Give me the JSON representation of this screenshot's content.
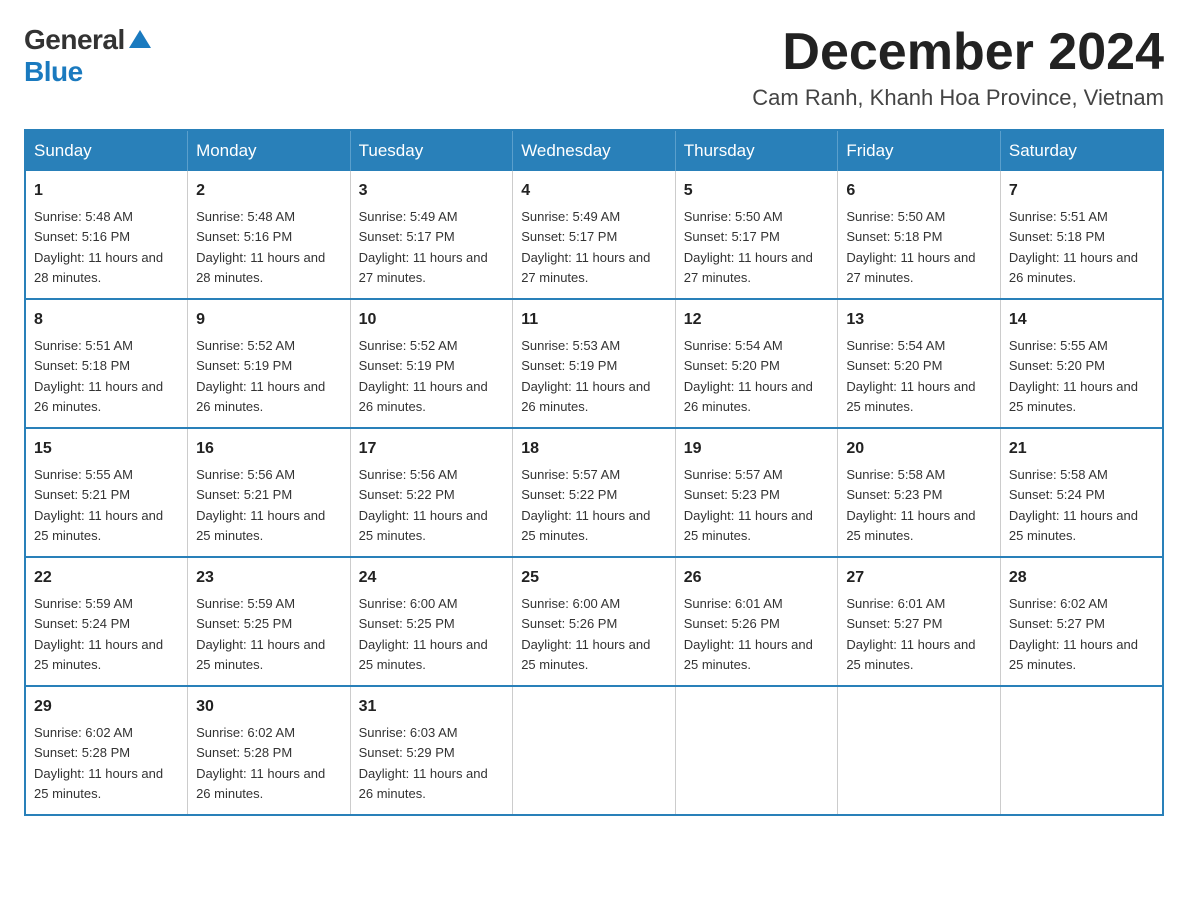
{
  "logo": {
    "general": "General",
    "blue": "Blue"
  },
  "title": "December 2024",
  "location": "Cam Ranh, Khanh Hoa Province, Vietnam",
  "weekdays": [
    "Sunday",
    "Monday",
    "Tuesday",
    "Wednesday",
    "Thursday",
    "Friday",
    "Saturday"
  ],
  "weeks": [
    [
      {
        "day": "1",
        "sunrise": "5:48 AM",
        "sunset": "5:16 PM",
        "daylight": "11 hours and 28 minutes."
      },
      {
        "day": "2",
        "sunrise": "5:48 AM",
        "sunset": "5:16 PM",
        "daylight": "11 hours and 28 minutes."
      },
      {
        "day": "3",
        "sunrise": "5:49 AM",
        "sunset": "5:17 PM",
        "daylight": "11 hours and 27 minutes."
      },
      {
        "day": "4",
        "sunrise": "5:49 AM",
        "sunset": "5:17 PM",
        "daylight": "11 hours and 27 minutes."
      },
      {
        "day": "5",
        "sunrise": "5:50 AM",
        "sunset": "5:17 PM",
        "daylight": "11 hours and 27 minutes."
      },
      {
        "day": "6",
        "sunrise": "5:50 AM",
        "sunset": "5:18 PM",
        "daylight": "11 hours and 27 minutes."
      },
      {
        "day": "7",
        "sunrise": "5:51 AM",
        "sunset": "5:18 PM",
        "daylight": "11 hours and 26 minutes."
      }
    ],
    [
      {
        "day": "8",
        "sunrise": "5:51 AM",
        "sunset": "5:18 PM",
        "daylight": "11 hours and 26 minutes."
      },
      {
        "day": "9",
        "sunrise": "5:52 AM",
        "sunset": "5:19 PM",
        "daylight": "11 hours and 26 minutes."
      },
      {
        "day": "10",
        "sunrise": "5:52 AM",
        "sunset": "5:19 PM",
        "daylight": "11 hours and 26 minutes."
      },
      {
        "day": "11",
        "sunrise": "5:53 AM",
        "sunset": "5:19 PM",
        "daylight": "11 hours and 26 minutes."
      },
      {
        "day": "12",
        "sunrise": "5:54 AM",
        "sunset": "5:20 PM",
        "daylight": "11 hours and 26 minutes."
      },
      {
        "day": "13",
        "sunrise": "5:54 AM",
        "sunset": "5:20 PM",
        "daylight": "11 hours and 25 minutes."
      },
      {
        "day": "14",
        "sunrise": "5:55 AM",
        "sunset": "5:20 PM",
        "daylight": "11 hours and 25 minutes."
      }
    ],
    [
      {
        "day": "15",
        "sunrise": "5:55 AM",
        "sunset": "5:21 PM",
        "daylight": "11 hours and 25 minutes."
      },
      {
        "day": "16",
        "sunrise": "5:56 AM",
        "sunset": "5:21 PM",
        "daylight": "11 hours and 25 minutes."
      },
      {
        "day": "17",
        "sunrise": "5:56 AM",
        "sunset": "5:22 PM",
        "daylight": "11 hours and 25 minutes."
      },
      {
        "day": "18",
        "sunrise": "5:57 AM",
        "sunset": "5:22 PM",
        "daylight": "11 hours and 25 minutes."
      },
      {
        "day": "19",
        "sunrise": "5:57 AM",
        "sunset": "5:23 PM",
        "daylight": "11 hours and 25 minutes."
      },
      {
        "day": "20",
        "sunrise": "5:58 AM",
        "sunset": "5:23 PM",
        "daylight": "11 hours and 25 minutes."
      },
      {
        "day": "21",
        "sunrise": "5:58 AM",
        "sunset": "5:24 PM",
        "daylight": "11 hours and 25 minutes."
      }
    ],
    [
      {
        "day": "22",
        "sunrise": "5:59 AM",
        "sunset": "5:24 PM",
        "daylight": "11 hours and 25 minutes."
      },
      {
        "day": "23",
        "sunrise": "5:59 AM",
        "sunset": "5:25 PM",
        "daylight": "11 hours and 25 minutes."
      },
      {
        "day": "24",
        "sunrise": "6:00 AM",
        "sunset": "5:25 PM",
        "daylight": "11 hours and 25 minutes."
      },
      {
        "day": "25",
        "sunrise": "6:00 AM",
        "sunset": "5:26 PM",
        "daylight": "11 hours and 25 minutes."
      },
      {
        "day": "26",
        "sunrise": "6:01 AM",
        "sunset": "5:26 PM",
        "daylight": "11 hours and 25 minutes."
      },
      {
        "day": "27",
        "sunrise": "6:01 AM",
        "sunset": "5:27 PM",
        "daylight": "11 hours and 25 minutes."
      },
      {
        "day": "28",
        "sunrise": "6:02 AM",
        "sunset": "5:27 PM",
        "daylight": "11 hours and 25 minutes."
      }
    ],
    [
      {
        "day": "29",
        "sunrise": "6:02 AM",
        "sunset": "5:28 PM",
        "daylight": "11 hours and 25 minutes."
      },
      {
        "day": "30",
        "sunrise": "6:02 AM",
        "sunset": "5:28 PM",
        "daylight": "11 hours and 26 minutes."
      },
      {
        "day": "31",
        "sunrise": "6:03 AM",
        "sunset": "5:29 PM",
        "daylight": "11 hours and 26 minutes."
      },
      null,
      null,
      null,
      null
    ]
  ]
}
